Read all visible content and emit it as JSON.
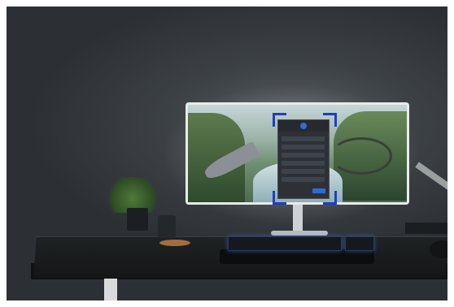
{
  "scene": {
    "kind": "photograph",
    "contents": [
      "curved-monitor",
      "on-screen-display-panel",
      "desk",
      "keyboard",
      "plant",
      "mug"
    ]
  },
  "colors": {
    "wall": "#3d4246",
    "desk": "#1a1d1f",
    "accent_blue": "#2f6bd6",
    "frame_corner": "#1f3fbf"
  }
}
